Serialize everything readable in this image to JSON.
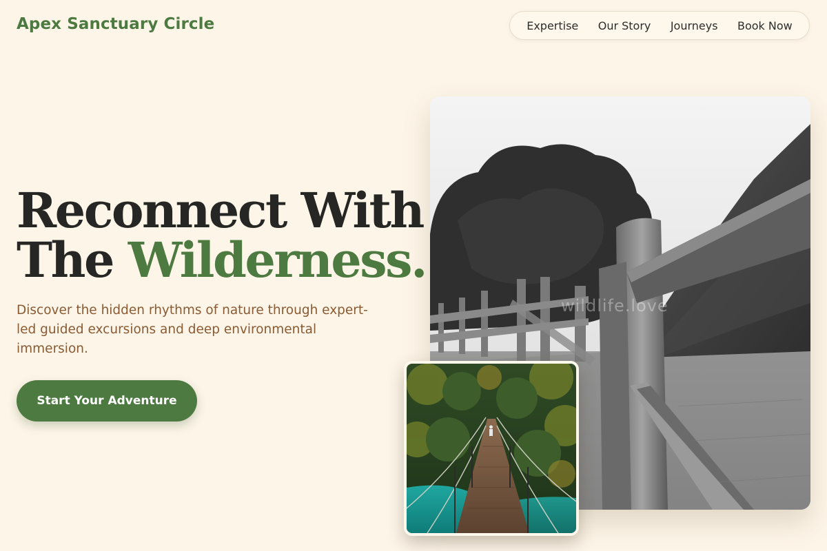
{
  "brand": {
    "name": "Apex Sanctuary Circle"
  },
  "nav": {
    "items": [
      {
        "label": "Expertise"
      },
      {
        "label": "Our Story"
      },
      {
        "label": "Journeys"
      },
      {
        "label": "Book Now"
      }
    ]
  },
  "hero": {
    "headline_line1": "Reconnect With",
    "headline_line2_plain": "The ",
    "headline_line2_accent": "Wilderness.",
    "subtext": "Discover the hidden rhythms of nature through expert-led guided excursions and deep environmental immersion.",
    "cta_label": "Start Your Adventure"
  },
  "images": {
    "main_watermark": "wildlife.love"
  },
  "colors": {
    "background": "#fdf5e8",
    "accent": "#4d7a40",
    "subtext": "#8a5a32",
    "heading": "#262624"
  }
}
